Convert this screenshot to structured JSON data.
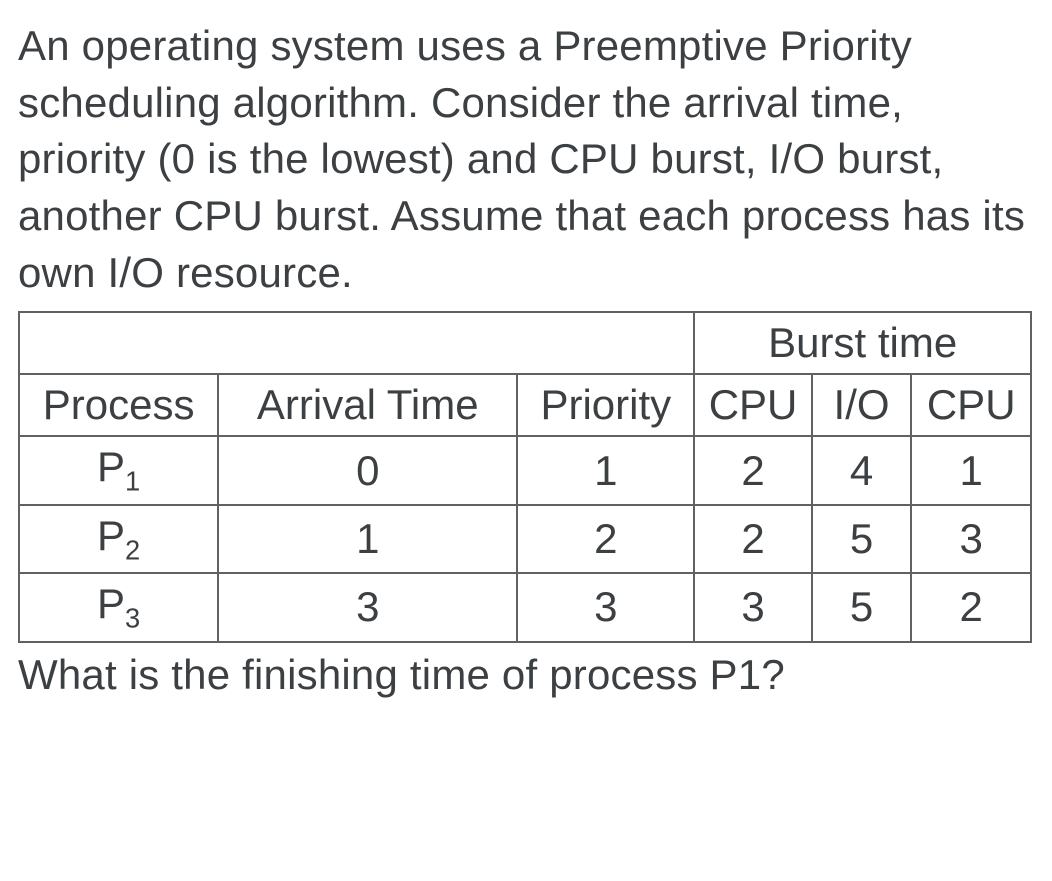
{
  "question": {
    "prompt": "An operating system uses a Preemptive Priority scheduling algorithm. Consider the arrival time, priority (0 is the lowest) and CPU burst, I/O burst, another CPU burst. Assume that each process has its own I/O resource.",
    "followup": "What is the finishing time of process P1?"
  },
  "table": {
    "group_header": "Burst time",
    "headers": {
      "process": "Process",
      "arrival": "Arrival Time",
      "priority": "Priority",
      "cpu1": "CPU",
      "io": "I/O",
      "cpu2": "CPU"
    },
    "rows": [
      {
        "process_base": "P",
        "process_sub": "1",
        "arrival": "0",
        "priority": "1",
        "cpu1": "2",
        "io": "4",
        "cpu2": "1"
      },
      {
        "process_base": "P",
        "process_sub": "2",
        "arrival": "1",
        "priority": "2",
        "cpu1": "2",
        "io": "5",
        "cpu2": "3"
      },
      {
        "process_base": "P",
        "process_sub": "3",
        "arrival": "3",
        "priority": "3",
        "cpu1": "3",
        "io": "5",
        "cpu2": "2"
      }
    ]
  }
}
